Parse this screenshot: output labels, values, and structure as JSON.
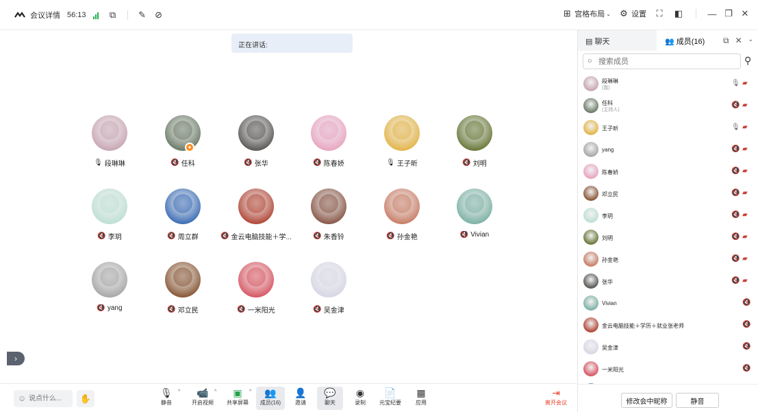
{
  "titlebar": {
    "meeting_info": "会议详情",
    "duration": "56:13",
    "layout_label": "宫格布局",
    "settings_label": "设置"
  },
  "speaking": {
    "label": "正在讲话:"
  },
  "participants": [
    {
      "name": "段琳琳",
      "mic": "on",
      "color": "#c9a7b4",
      "host": false
    },
    {
      "name": "任科",
      "mic": "off",
      "color": "#6e7d6a",
      "host": true
    },
    {
      "name": "张华",
      "mic": "off",
      "color": "#5d5a58",
      "host": false
    },
    {
      "name": "陈春娇",
      "mic": "off",
      "color": "#e8a6c2",
      "host": false
    },
    {
      "name": "王子昕",
      "mic": "on",
      "color": "#e4b64c",
      "host": false
    },
    {
      "name": "刘明",
      "mic": "off",
      "color": "#6b7a3c",
      "host": false
    },
    {
      "name": "李玥",
      "mic": "off",
      "color": "#bfe0d4",
      "host": false
    },
    {
      "name": "周立群",
      "mic": "off",
      "color": "#3f6fb6",
      "host": false
    },
    {
      "name": "金云电脑技能＋学...",
      "mic": "off",
      "color": "#b24a3b",
      "host": false
    },
    {
      "name": "朱香铃",
      "mic": "off",
      "color": "#8a5a4a",
      "host": false
    },
    {
      "name": "孙金艳",
      "mic": "off",
      "color": "#c9806a",
      "host": false
    },
    {
      "name": "Vivian",
      "mic": "off",
      "color": "#7fb3a6",
      "host": false
    },
    {
      "name": "yang",
      "mic": "off",
      "color": "#a9a9a9",
      "host": false
    },
    {
      "name": "邓立民",
      "mic": "off",
      "color": "#8b5a3a",
      "host": false
    },
    {
      "name": "一米阳光",
      "mic": "off",
      "color": "#d85a66",
      "host": false
    },
    {
      "name": "吴金津",
      "mic": "off",
      "color": "#d8d8e6",
      "host": false
    }
  ],
  "toolbar": {
    "say_placeholder": "说点什么...",
    "mute": "静音",
    "video": "开启视频",
    "share": "共享屏幕",
    "members": "成员(16)",
    "invite": "邀请",
    "chat": "聊天",
    "record": "录制",
    "minutes": "元宝纪要",
    "apps": "应用",
    "leave": "离开会议",
    "leave_color": "#e8412c"
  },
  "panel": {
    "tab_chat": "聊天",
    "tab_members": "成员(16)",
    "search_placeholder": "搜索成员",
    "members": [
      {
        "name": "段琳琳",
        "role": "(我)",
        "mic": "on",
        "color": "#c9a7b4"
      },
      {
        "name": "任科",
        "role": "(主持人)",
        "mic": "off",
        "color": "#6e7d6a"
      },
      {
        "name": "王子昕",
        "role": "",
        "mic": "on",
        "color": "#e4b64c"
      },
      {
        "name": "yang",
        "role": "",
        "mic": "off",
        "color": "#a9a9a9"
      },
      {
        "name": "陈春娇",
        "role": "",
        "mic": "off",
        "color": "#e8a6c2"
      },
      {
        "name": "邓立民",
        "role": "",
        "mic": "off",
        "color": "#8b5a3a"
      },
      {
        "name": "李玥",
        "role": "",
        "mic": "off",
        "color": "#bfe0d4"
      },
      {
        "name": "刘明",
        "role": "",
        "mic": "off",
        "color": "#6b7a3c"
      },
      {
        "name": "孙金艳",
        "role": "",
        "mic": "off",
        "color": "#c9806a"
      },
      {
        "name": "张华",
        "role": "",
        "mic": "off",
        "color": "#5d5a58"
      },
      {
        "name": "Vivian",
        "role": "",
        "mic": "off",
        "color": "#7fb3a6"
      },
      {
        "name": "金云电脑技能＋学历＋就业张老师",
        "role": "",
        "mic": "off",
        "color": "#b24a3b"
      },
      {
        "name": "吴金津",
        "role": "",
        "mic": "off",
        "color": "#d8d8e6"
      },
      {
        "name": "一米阳光",
        "role": "",
        "mic": "off",
        "color": "#d85a66"
      },
      {
        "name": "",
        "role": "",
        "mic": "off",
        "color": "#3f6fb6"
      }
    ],
    "rename_label": "修改会中昵称",
    "mute_all_label": "静音"
  }
}
